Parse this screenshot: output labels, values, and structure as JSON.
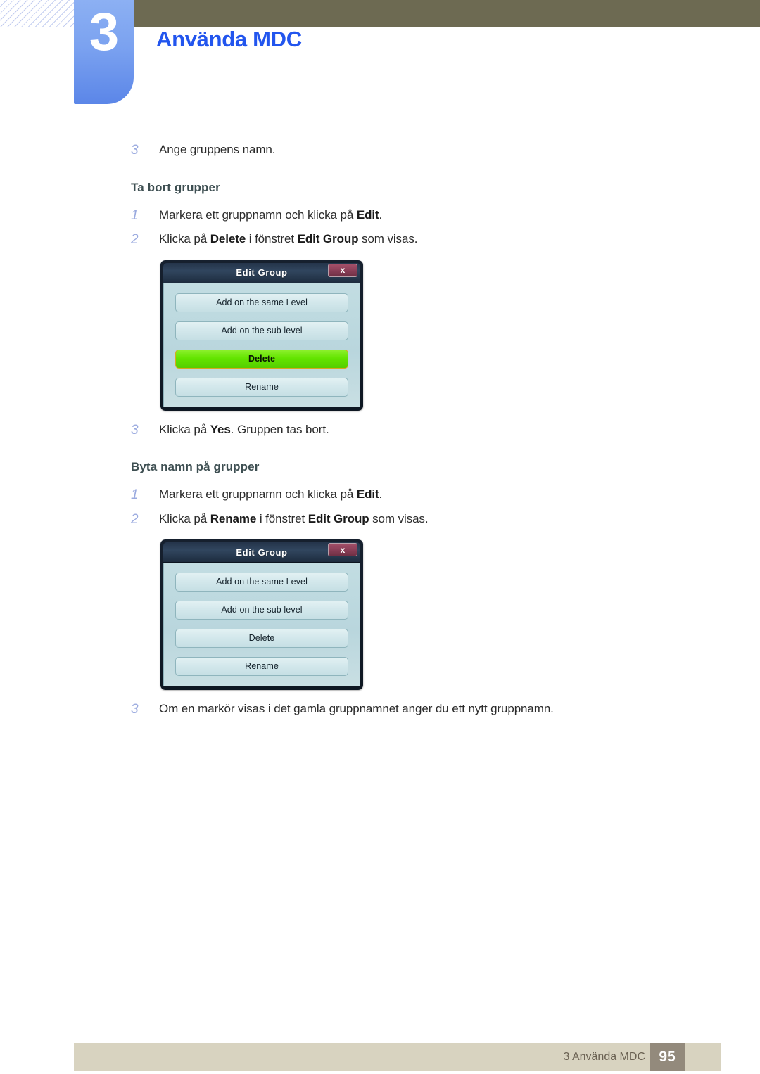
{
  "header": {
    "chapter_number": "3",
    "chapter_title": "Använda MDC",
    "accent_blue": "#2255ee",
    "tab_blue": "#7ba2f0",
    "olive": "#6d6a52"
  },
  "content": {
    "step_a": {
      "num": "3",
      "text": "Ange gruppens namn."
    },
    "section_delete": {
      "heading": "Ta bort grupper",
      "steps": [
        {
          "num": "1",
          "parts": [
            {
              "t": "Markera ett gruppnamn och klicka på ",
              "b": false
            },
            {
              "t": "Edit",
              "b": true
            },
            {
              "t": ".",
              "b": false
            }
          ]
        },
        {
          "num": "2",
          "parts": [
            {
              "t": "Klicka på ",
              "b": false
            },
            {
              "t": "Delete",
              "b": true
            },
            {
              "t": " i fönstret ",
              "b": false
            },
            {
              "t": "Edit Group",
              "b": true
            },
            {
              "t": " som visas.",
              "b": false
            }
          ]
        },
        {
          "num": "3",
          "parts": [
            {
              "t": "Klicka på ",
              "b": false
            },
            {
              "t": "Yes",
              "b": true
            },
            {
              "t": ". Gruppen tas bort.",
              "b": false
            }
          ]
        }
      ]
    },
    "section_rename": {
      "heading": "Byta namn på grupper",
      "steps": [
        {
          "num": "1",
          "parts": [
            {
              "t": "Markera ett gruppnamn och klicka på ",
              "b": false
            },
            {
              "t": "Edit",
              "b": true
            },
            {
              "t": ".",
              "b": false
            }
          ]
        },
        {
          "num": "2",
          "parts": [
            {
              "t": "Klicka på ",
              "b": false
            },
            {
              "t": "Rename",
              "b": true
            },
            {
              "t": " i fönstret ",
              "b": false
            },
            {
              "t": "Edit Group",
              "b": true
            },
            {
              "t": " som visas.",
              "b": false
            }
          ]
        },
        {
          "num": "3",
          "parts": [
            {
              "t": "Om en markör visas i det gamla gruppnamnet anger du ett nytt gruppnamn.",
              "b": false
            }
          ]
        }
      ]
    }
  },
  "dialogs": [
    {
      "id": "edit-group-delete",
      "title": "Edit Group",
      "close_label": "x",
      "buttons": [
        {
          "label": "Add on the same Level",
          "highlighted": false
        },
        {
          "label": "Add on the sub level",
          "highlighted": false
        },
        {
          "label": "Delete",
          "highlighted": true
        },
        {
          "label": "Rename",
          "highlighted": false
        }
      ],
      "highlight_color": "#63e400",
      "button_color": "#d2e7eb",
      "titlebar_color": "#31465f",
      "close_color": "#8b3f58"
    },
    {
      "id": "edit-group-rename",
      "title": "Edit Group",
      "close_label": "x",
      "buttons": [
        {
          "label": "Add on the same Level",
          "highlighted": false
        },
        {
          "label": "Add on the sub level",
          "highlighted": false
        },
        {
          "label": "Delete",
          "highlighted": false
        },
        {
          "label": "Rename",
          "highlighted": false
        }
      ],
      "button_color": "#d2e7eb",
      "titlebar_color": "#31465f",
      "close_color": "#8b3f58"
    }
  ],
  "footer": {
    "label": "3 Använda MDC",
    "page_number": "95",
    "bar_color": "#d8d3c0",
    "page_box_color": "#938a7c"
  }
}
